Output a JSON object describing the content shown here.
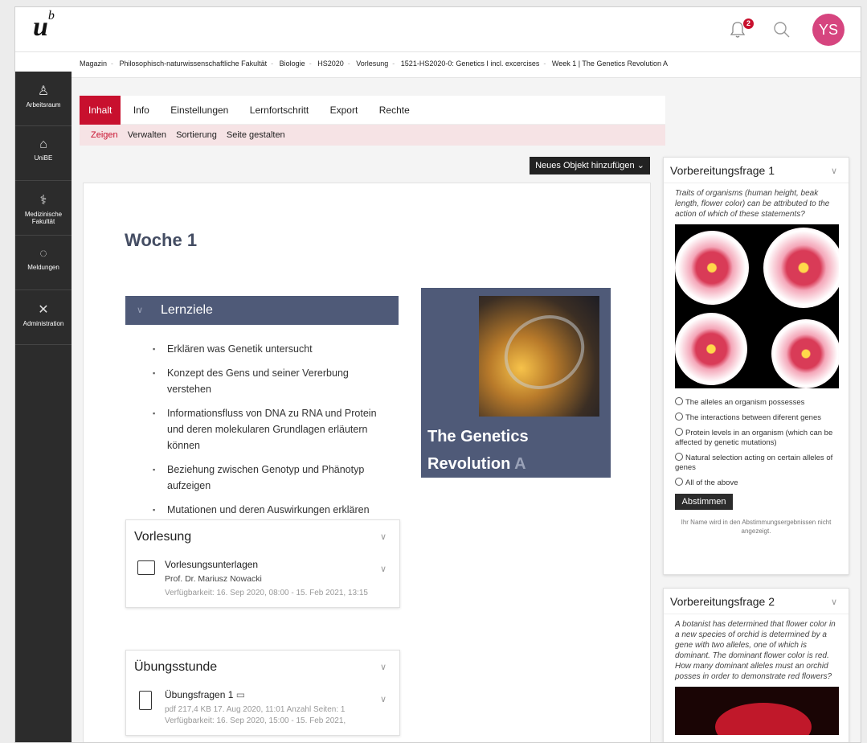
{
  "header": {
    "logo_main": "u",
    "logo_sup": "b",
    "notifications_count": "2",
    "user_initials": "YS",
    "avatar_color": "#d6457f",
    "accent_color": "#c8102e"
  },
  "breadcrumbs": [
    "Magazin",
    "Philosophisch-naturwissenschaftliche Fakultät",
    "Biologie",
    "HS2020",
    "Vorlesung",
    "1521-HS2020-0: Genetics I incl. excercises",
    "Week 1 | The Genetics Revolution A"
  ],
  "sidebar": {
    "items": [
      {
        "label": "Arbeitsraum",
        "icon": "person-icon"
      },
      {
        "label": "UniBE",
        "icon": "building-icon"
      },
      {
        "label": "Medizinische Fakultät",
        "icon": "caduceus-icon"
      },
      {
        "label": "Meldungen",
        "icon": "chat-icon"
      },
      {
        "label": "Administration",
        "icon": "tools-icon"
      }
    ]
  },
  "tabs": [
    "Inhalt",
    "Info",
    "Einstellungen",
    "Lernfortschritt",
    "Export",
    "Rechte"
  ],
  "subtabs": [
    "Zeigen",
    "Verwalten",
    "Sortierung",
    "Seite gestalten"
  ],
  "add_object_label": "Neues Objekt hinzufügen",
  "main": {
    "title": "Woche 1",
    "lernziele": {
      "title": "Lernziele",
      "items": [
        "Erklären was Genetik untersucht",
        "Konzept des Gens und seiner Vererbung verstehen",
        "Informationsfluss von DNA zu RNA und Protein und deren molekularen Grundlagen erläutern können",
        "Beziehung zwischen Genotyp und Phänotyp aufzeigen",
        "Mutationen und deren Auswirkungen erklären"
      ]
    },
    "book": {
      "title1": "The Genetics",
      "title2": "Revolution",
      "title_suffix": "A"
    },
    "vorlesung": {
      "title": "Vorlesung",
      "entry_title": "Vorlesungsunterlagen",
      "entry_author": "Prof. Dr. Mariusz Nowacki",
      "entry_availability": "Verfügbarkeit: 16. Sep 2020, 08:00 - 15. Feb 2021, 13:15"
    },
    "uebungsstunde": {
      "title": "Übungsstunde",
      "entry_title": "Übungsfragen 1",
      "entry_meta": "pdf   217,4 KB   17. Aug 2020, 11:01   Anzahl Seiten: 1",
      "entry_availability": "Verfügbarkeit: 16. Sep 2020, 15:00 - 15. Feb 2021,"
    }
  },
  "poll1": {
    "title": "Vorbereitungsfrage 1",
    "question": "Traits of organisms (human height, beak length, flower color) can be attributed to the action of which of these statements?",
    "options": [
      "The alleles an organism possesses",
      "The interactions between diferent genes",
      "Protein levels in an organism (which can be affected by genetic mutations)",
      "Natural selection acting on certain alleles of genes",
      "All of the above"
    ],
    "vote_label": "Abstimmen",
    "note": "Ihr Name wird in den Abstimmungsergebnissen nicht angezeigt."
  },
  "poll2": {
    "title": "Vorbereitungsfrage 2",
    "question": "A botanist has determined that flower color in a new species of orchid is determined by a gene with two alleles, one of which is dominant. The dominant flower color is red. How many dominant alleles must an orchid posses in order to demonstrate red flowers?"
  }
}
